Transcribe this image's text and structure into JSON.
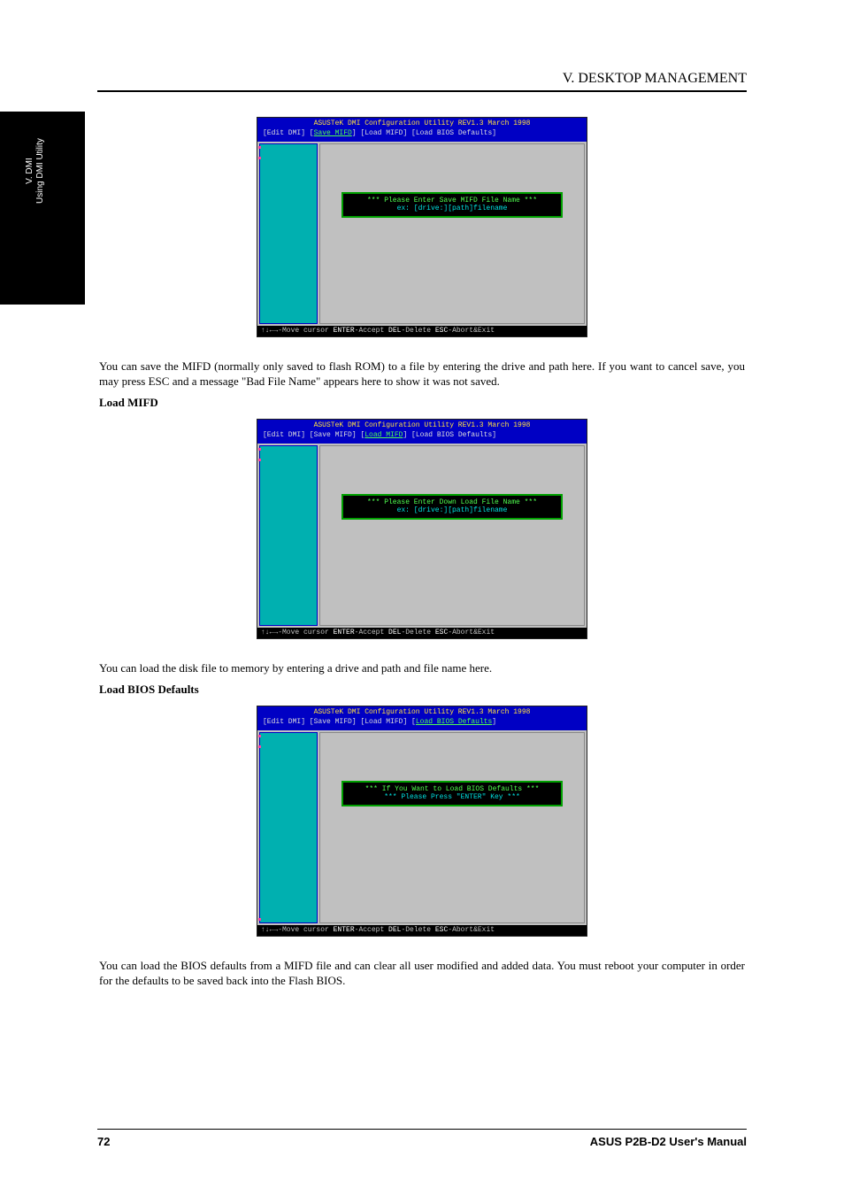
{
  "header": {
    "title": "V. DESKTOP MANAGEMENT"
  },
  "sidetab": {
    "line1": "V. DMI",
    "line2": "Using DMI Utility"
  },
  "screens": {
    "common": {
      "app_title": "ASUSTeK DMI Configuration Utility  REV1.3  March 1998",
      "menu_prefix": "[Edit DMI] [",
      "menu_sep": "] [",
      "menu_save": "Save MIFD",
      "menu_load": "Load MIFD",
      "menu_bios": "Load BIOS Defaults",
      "menu_suffix": "]",
      "status": {
        "move": "↑↓←→-Move cursor ",
        "enter": "ENTER",
        "enter2": "-Accept ",
        "del": "DEL",
        "del2": "-Delete ",
        "esc": "ESC",
        "esc2": "-Abort&Exit"
      }
    },
    "s1": {
      "d1": "*** Please Enter Save MIFD File Name ***",
      "d2": "ex: [drive:][path]filename"
    },
    "s2": {
      "d1": "*** Please Enter Down Load File Name ***",
      "d2": "ex: [drive:][path]filename"
    },
    "s3": {
      "d1": "*** If You Want to Load BIOS Defaults ***",
      "d2": "*** Please Press \"ENTER\" Key ***"
    }
  },
  "text": {
    "p1": "You can save the MIFD (normally only saved to flash ROM) to a file by entering the drive and path here. If you want to cancel save, you may press ESC and a message \"Bad File Name\" appears here to show it was not saved.",
    "h2": "Load MIFD",
    "p2": "You can load the disk file to memory by entering a drive and path and file name here.",
    "h3": "Load BIOS Defaults",
    "p3": "You can load the BIOS defaults from a MIFD file and can clear all user modified and added data. You must reboot your computer in order for the defaults to be saved back into the Flash BIOS."
  },
  "footer": {
    "page": "72",
    "product": "ASUS P2B-D2 User's Manual"
  }
}
